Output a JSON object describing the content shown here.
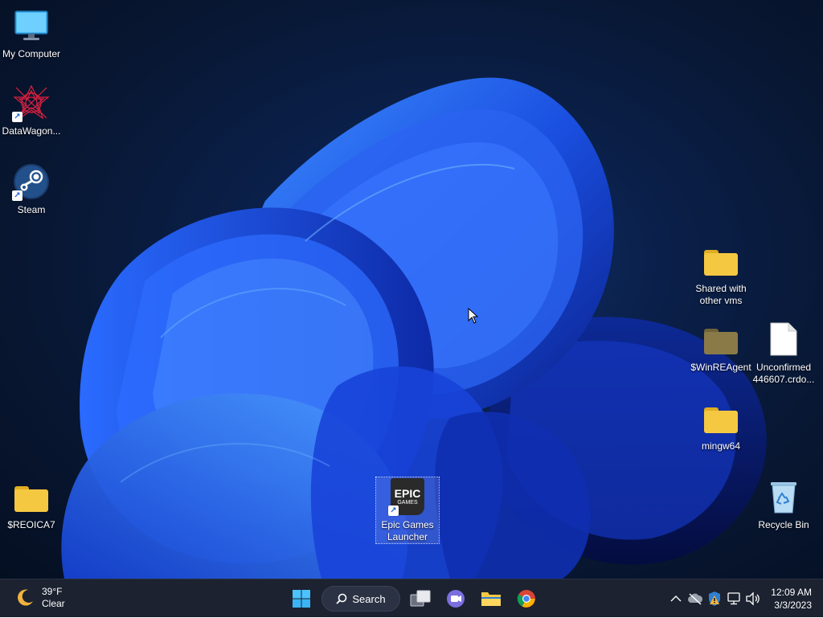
{
  "desktop": {
    "icons": {
      "my_computer": "My Computer",
      "datawagon": "DataWagon...",
      "steam": "Steam",
      "reoica7": "$REOICA7",
      "epic": "Epic Games\nLauncher",
      "epic_logo_line1": "EPIC",
      "epic_logo_line2": "GAMES",
      "shared": "Shared with\nother vms",
      "winreagent": "$WinREAgent",
      "unconfirmed": "Unconfirmed\n446607.crdo...",
      "mingw64": "mingw64",
      "recycle_bin": "Recycle Bin"
    },
    "colors": {
      "folder": "#f5c842",
      "folder_dark": "#e0ad22",
      "hidden_folder": "#8a7a48",
      "accent": "#0a5fd8"
    }
  },
  "taskbar": {
    "weather": {
      "temp": "39°F",
      "condition": "Clear",
      "icon": "moon-icon"
    },
    "search_label": "Search",
    "pinned": [
      "start-icon",
      "task-view-icon",
      "teams-chat-icon",
      "file-explorer-icon",
      "chrome-icon"
    ],
    "tray": [
      "chevron-up-icon",
      "onedrive-offline-icon",
      "security-warning-icon",
      "network-icon",
      "volume-icon"
    ],
    "clock": {
      "time": "12:09 AM",
      "date": "3/3/2023"
    }
  }
}
